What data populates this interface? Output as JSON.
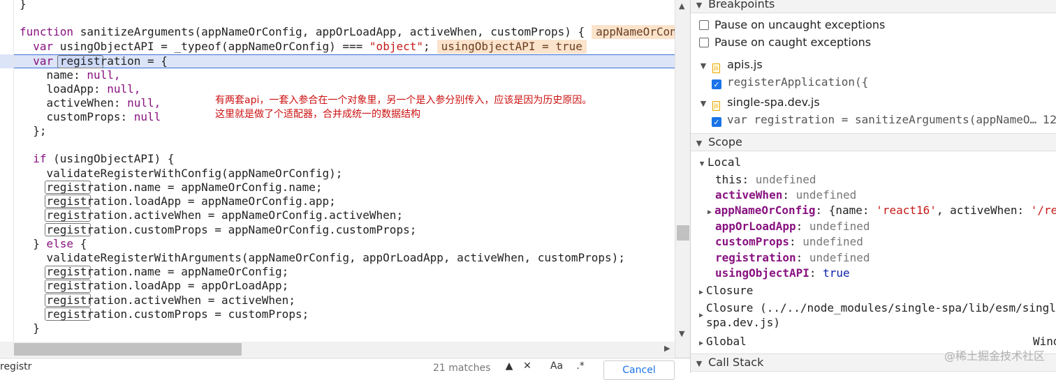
{
  "editor": {
    "lines": {
      "l0": "}",
      "l2_kw": "function",
      "l2_rest": " sanitizeArguments(appNameOrConfig, appOrLoadApp, activeWhen, customProps) {",
      "l2_inline": "appNameOrConfig",
      "l3_kw": "  var",
      "l3_rest": " usingObjectAPI = _typeof(appNameOrConfig) === ",
      "l3_str": "\"object\"",
      "l3_end": ";",
      "l3_inline": "usingObjectAPI = true",
      "l4_kw": "  var",
      "l4_rest": " registration = {",
      "l5": "    name: ",
      "l5_null": "null,",
      "l6": "    loadApp: ",
      "l6_null": "null,",
      "l7": "    activeWhen: ",
      "l7_null": "null,",
      "l8": "    customProps: ",
      "l8_null": "null",
      "l9": "  };",
      "l11_kw": "  if",
      "l11_rest": " (usingObjectAPI) {",
      "l12": "    validateRegisterWithConfig(appNameOrConfig);",
      "l13": "    registration.name = appNameOrConfig.name;",
      "l14": "    registration.loadApp = appNameOrConfig.app;",
      "l15": "    registration.activeWhen = appNameOrConfig.activeWhen;",
      "l16": "    registration.customProps = appNameOrConfig.customProps;",
      "l17_a": "  } ",
      "l17_kw": "else",
      "l17_b": " {",
      "l18": "    validateRegisterWithArguments(appNameOrConfig, appOrLoadApp, activeWhen, customProps);",
      "l19": "    registration.name = appNameOrConfig;",
      "l20": "    registration.loadApp = appOrLoadApp;",
      "l21": "    registration.activeWhen = activeWhen;",
      "l22": "    registration.customProps = customProps;",
      "l23": "  }"
    },
    "annotation_line1": "有两套api，一套入参合在一个对象里，另一个是入参分别传入，应该是因为历史原因。",
    "annotation_line2": "这里就是做了个适配器，合并成统一的数据结构"
  },
  "search": {
    "query": "registr",
    "count": "21 matches",
    "cancel_label": "Cancel",
    "case_label": "Aa",
    "regex_label": ".*"
  },
  "sidebar": {
    "breakpoints": {
      "title": "Breakpoints",
      "pause_uncaught": "Pause on uncaught exceptions",
      "pause_caught": "Pause on caught exceptions",
      "files": [
        {
          "name": "apis.js",
          "bp_code": "registerApplication({"
        },
        {
          "name": "single-spa.dev.js",
          "bp_code": "var registration = sanitizeArguments(appNameO…",
          "line": "12"
        }
      ]
    },
    "scope": {
      "title": "Scope",
      "local_title": "Local",
      "vars": {
        "this_key": "this",
        "this_val": "undefined",
        "activeWhen_key": "activeWhen",
        "activeWhen_val": "undefined",
        "appNameOrConfig_key": "appNameOrConfig",
        "appNameOrConfig_val_a": "{name: ",
        "appNameOrConfig_val_str": "'react16'",
        "appNameOrConfig_val_b": ", activeWhen: ",
        "appNameOrConfig_val_str2": "'/reac",
        "appOrLoadApp_key": "appOrLoadApp",
        "appOrLoadApp_val": "undefined",
        "customProps_key": "customProps",
        "customProps_val": "undefined",
        "registration_key": "registration",
        "registration_val": "undefined",
        "usingObjectAPI_key": "usingObjectAPI",
        "usingObjectAPI_val": "true"
      },
      "closure": "Closure",
      "closure_path_1": "Closure (../../node_modules/single-spa/lib/esm/single-",
      "closure_path_2": "spa.dev.js)",
      "global": "Global",
      "global_val": "Wind"
    },
    "callstack_title": "Call Stack"
  },
  "watermark": "@稀土掘金技术社区",
  "colors": {
    "keyword": "#881280",
    "string": "#c41a16",
    "highlight_line": "#dce4f7",
    "inline_value": "#fbe3cc",
    "annotation": "#cc1111",
    "checkbox_checked": "#1a73e8"
  }
}
